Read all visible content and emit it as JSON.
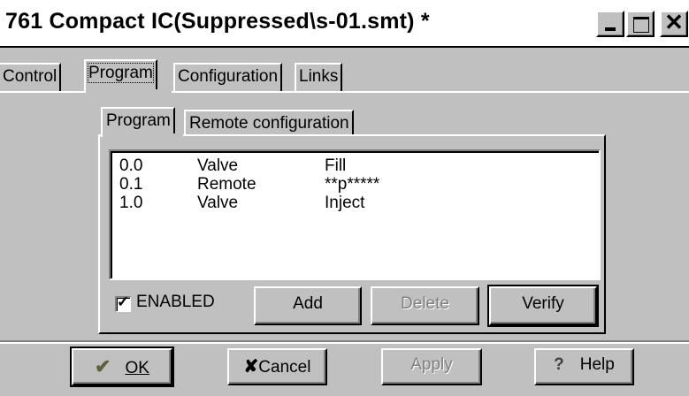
{
  "window": {
    "title": "761 Compact IC(Suppressed\\s-01.smt) *",
    "controls": [
      "minimize-icon",
      "maximize-icon",
      "close-icon"
    ]
  },
  "tabs": [
    {
      "label": "Control"
    },
    {
      "label": "Program",
      "active": true
    },
    {
      "label": "Configuration"
    },
    {
      "label": "Links"
    }
  ],
  "inner_tabs": [
    {
      "label": "Program",
      "active": true
    },
    {
      "label": "Remote configuration"
    }
  ],
  "program_list": [
    {
      "time": "0.0",
      "device": "Valve",
      "action": "Fill"
    },
    {
      "time": "0.1",
      "device": "Remote",
      "action": "**p*****"
    },
    {
      "time": "1.0",
      "device": "Valve",
      "action": "Inject"
    }
  ],
  "enabled": {
    "label": "ENABLED",
    "checked": true
  },
  "list_buttons": {
    "add": "Add",
    "delete": "Delete",
    "verify": "Verify"
  },
  "footer": {
    "ok": "OK",
    "cancel": "Cancel",
    "apply": "Apply",
    "help": "Help"
  }
}
